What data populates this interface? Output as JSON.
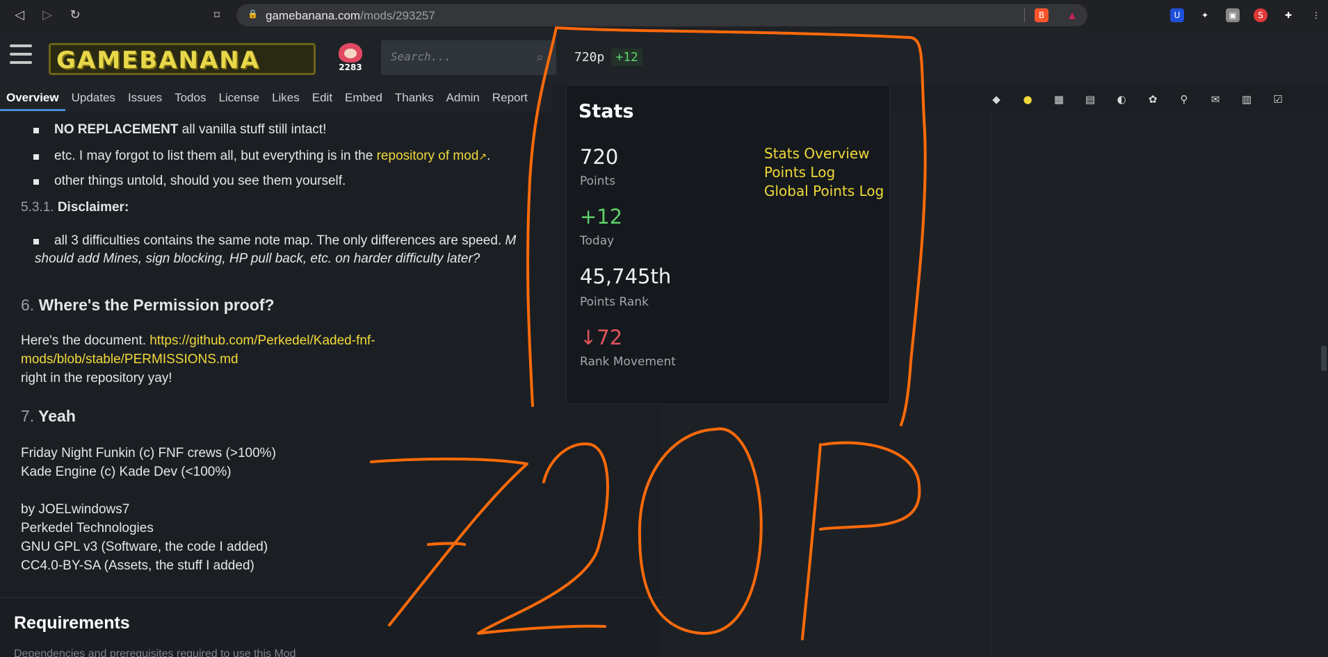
{
  "browser": {
    "back_glyph": "◁",
    "forward_glyph": "▷",
    "reload_glyph": "↻",
    "bookmark_glyph": "⌑",
    "lock_glyph": "🔒",
    "url_domain": "gamebanana.com",
    "url_path": "/mods/293257",
    "extensions": [
      {
        "icon": "brave-shield-icon",
        "glyph": "B",
        "color": "#fb542b"
      },
      {
        "icon": "triangle-icon",
        "glyph": "▲",
        "color": "#d02050"
      },
      {
        "icon": "bitwarden-icon",
        "glyph": "U",
        "color": "#1e4fd8"
      },
      {
        "icon": "hacker-icon",
        "glyph": "✦",
        "color": "#555"
      },
      {
        "icon": "screen-icon",
        "glyph": "▣",
        "color": "#888"
      },
      {
        "icon": "s-badge-icon",
        "glyph": "S",
        "color": "#e03a3a"
      },
      {
        "icon": "puzzle-icon",
        "glyph": "✚",
        "color": "#444"
      },
      {
        "icon": "menu-icon",
        "glyph": "⋮",
        "color": "#333"
      }
    ]
  },
  "header": {
    "logo_text": "GAMEBANANA",
    "avatar_count": "2283",
    "search_placeholder": "Search...",
    "search_glyph": "⌕",
    "points_value": "720p",
    "points_delta": "+12"
  },
  "tabs": [
    "Overview",
    "Updates",
    "Issues",
    "Todos",
    "License",
    "Likes",
    "Edit",
    "Embed",
    "Thanks",
    "Admin",
    "Report"
  ],
  "toolbar_glyphs": [
    "◆",
    "●",
    "▦",
    "▤",
    "◐",
    "✿",
    "⚲",
    "✉",
    "▥",
    "☑"
  ],
  "content": {
    "bullet1_bold": "NO REPLACEMENT",
    "bullet1_rest": " all vanilla stuff still intact!",
    "bullet2_text": "etc. I may forgot to list them all, but everything is in the ",
    "bullet2_link": "repository of mod",
    "bullet2_ext": "↗",
    "bullet2_end": ".",
    "bullet3_text": "other things untold, should you see them yourself.",
    "sub_num": "5.3.1.",
    "sub_title": "Disclaimer:",
    "bullet4_text": "all 3 difficulties contains the same note map. The only differences are speed. ",
    "bullet4_ital": "M",
    "bullet4_line2": "should add Mines, sign blocking, HP pull back, etc. on harder difficulty later?",
    "h6_num": "6.",
    "h6_title": "Where's the Permission proof?",
    "perm_text": "Here's the document. ",
    "perm_link1": "https://github.com/Perkedel/Kaded-fnf-",
    "perm_link2": "mods/blob/stable/PERMISSIONS.md",
    "perm_line3": "right in the repository yay!",
    "h7_num": "7.",
    "h7_title": "Yeah",
    "credits": [
      "Friday Night Funkin (c) FNF crews (>100%)",
      "Kade Engine (c) Kade Dev (<100%)",
      "",
      "by JOELwindows7",
      "Perkedel Technologies",
      "GNU GPL v3 (Software, the code I added)",
      "CC4.0-BY-SA (Assets, the stuff I added)"
    ],
    "requirements_title": "Requirements",
    "requirements_sub": "Dependencies and prerequisites required to use this Mod"
  },
  "stats": {
    "title": "Stats",
    "points": "720",
    "points_label": "Points",
    "today": "+12",
    "today_label": "Today",
    "rank": "45,745th",
    "rank_label": "Points Rank",
    "movement": "↓72",
    "movement_label": "Rank Movement",
    "links": [
      "Stats Overview",
      "Points Log",
      "Global Points Log"
    ]
  },
  "annotation": {
    "color": "#ff6a0a"
  }
}
